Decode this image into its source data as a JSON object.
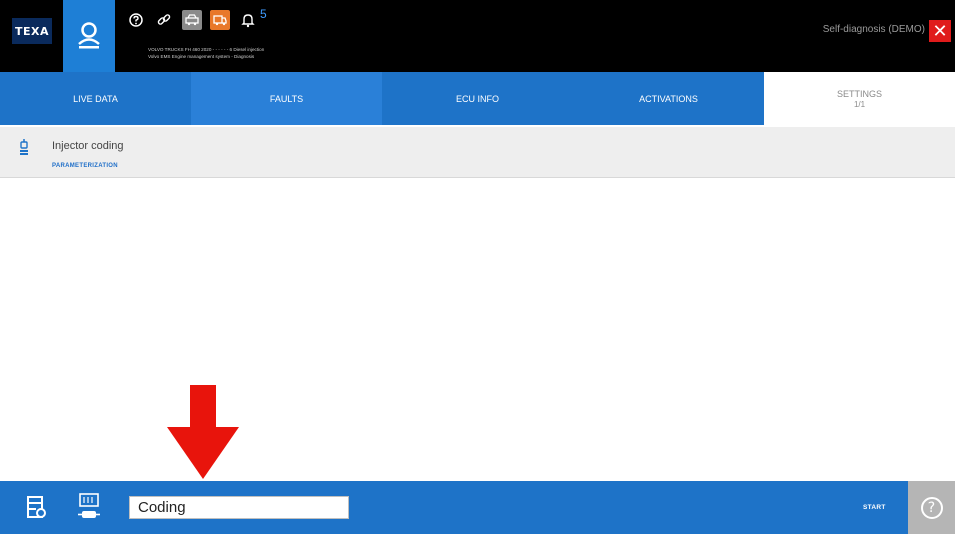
{
  "header": {
    "logo_text": "TEXA",
    "vehicle_line1": "VOLVO TRUCKS FH 460 2020 - - - - - - 6 Diesel injection",
    "vehicle_line2": "Volvo EMS Engine management system - Diagnosis",
    "notifications_count": "5",
    "mode_label": "Self-diagnosis (DEMO)",
    "close_label": "✕",
    "icons": [
      "user-profile-icon",
      "question-icon",
      "link-icon",
      "car-icon",
      "truck-icon",
      "bell-icon"
    ]
  },
  "tabs": [
    {
      "label": "LIVE DATA",
      "sub": ""
    },
    {
      "label": "FAULTS",
      "sub": ""
    },
    {
      "label": "ECU INFO",
      "sub": ""
    },
    {
      "label": "ACTIVATIONS",
      "sub": ""
    },
    {
      "label": "SETTINGS",
      "sub": "1/1"
    }
  ],
  "procedure": {
    "title": "Injector coding",
    "subtitle": "PARAMETERIZATION"
  },
  "footer": {
    "input_value": "Coding",
    "start_label": "START",
    "help_label": "?"
  },
  "colors": {
    "accent_blue": "#1e73c8",
    "arrow_red": "#e8140c",
    "close_red": "#e01b1b",
    "topbar": "#000000"
  }
}
